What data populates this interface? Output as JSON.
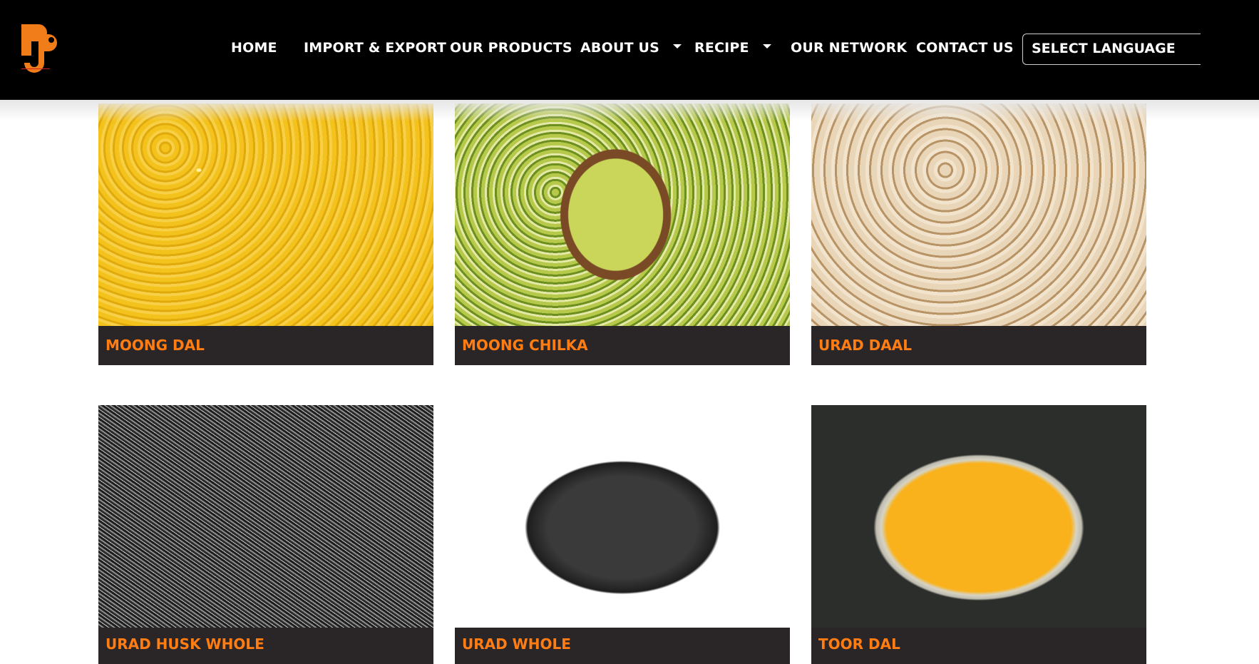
{
  "navbar": {
    "logo_name": "RSP logo",
    "items": [
      {
        "label": "HOME",
        "dropdown": false
      },
      {
        "label": "IMPORT & EXPORT",
        "dropdown": false
      },
      {
        "label": "OUR PRODUCTS",
        "dropdown": false
      },
      {
        "label": "ABOUT US",
        "dropdown": true
      },
      {
        "label": "RECIPE",
        "dropdown": true
      },
      {
        "label": "OUR NETWORK",
        "dropdown": false
      },
      {
        "label": "CONTACT US",
        "dropdown": false
      }
    ],
    "language_select": "SELECT LANGUAGE"
  },
  "products": [
    {
      "name": "MOONG DAL",
      "image": "moong-dal-image"
    },
    {
      "name": "MOONG CHILKA",
      "image": "moong-chilka-image"
    },
    {
      "name": "URAD DAAL",
      "image": "urad-daal-image"
    },
    {
      "name": "URAD HUSK WHOLE",
      "image": "urad-husk-whole-image"
    },
    {
      "name": "URAD WHOLE",
      "image": "urad-whole-image"
    },
    {
      "name": "TOOR DAL",
      "image": "toor-dal-image"
    }
  ],
  "colors": {
    "navbar_bg": "#000000",
    "card_caption_bg": "#2a2628",
    "product_label": "#ff7d13",
    "logo_orange": "#f07d1a"
  }
}
